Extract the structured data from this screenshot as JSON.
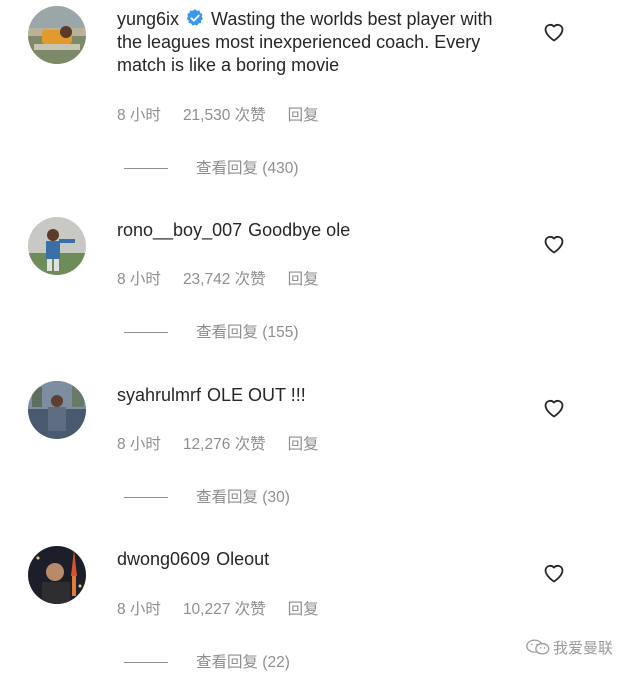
{
  "comments": [
    {
      "username": "yung6ix",
      "verified": true,
      "text": "Wasting the worlds best player with the leagues most inexperienced coach. Every match is like a boring movie",
      "time": "8 小时",
      "likes": "21,530 次赞",
      "reply": "回复",
      "view_replies": "查看回复 (430)"
    },
    {
      "username": "rono__boy_007",
      "verified": false,
      "text": "Goodbye ole",
      "time": "8 小时",
      "likes": "23,742 次赞",
      "reply": "回复",
      "view_replies": "查看回复 (155)"
    },
    {
      "username": "syahrulmrf",
      "verified": false,
      "text": "OLE OUT !!!",
      "time": "8 小时",
      "likes": "12,276 次赞",
      "reply": "回复",
      "view_replies": "查看回复 (30)"
    },
    {
      "username": "dwong0609",
      "verified": false,
      "text": "Oleout",
      "time": "8 小时",
      "likes": "10,227 次赞",
      "reply": "回复",
      "view_replies": "查看回复 (22)"
    }
  ],
  "icons": {
    "like": "heart-icon",
    "verified": "verified-badge-icon",
    "watermark": "wechat-icon"
  },
  "colors": {
    "text": "#262626",
    "meta": "#8e8e8e",
    "verified": "#3897f0"
  },
  "watermark": "我爱曼联"
}
